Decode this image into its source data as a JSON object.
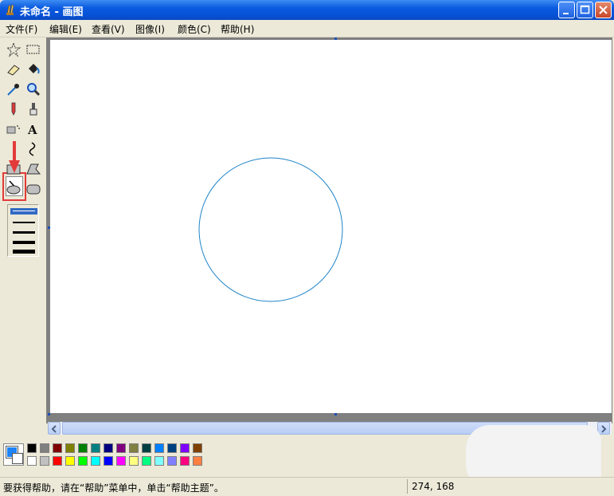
{
  "window": {
    "title": "未命名 - 画图",
    "controls": {
      "minimize": "minimize",
      "maximize": "maximize",
      "close": "close"
    }
  },
  "menu": {
    "items": [
      "文件(F)",
      "编辑(E)",
      "查看(V)",
      "图像(I)",
      "颜色(C)",
      "帮助(H)"
    ]
  },
  "toolbox": {
    "tools": [
      "free-form-select",
      "select",
      "eraser",
      "fill-with-color",
      "pick-color",
      "magnifier",
      "pencil",
      "brush",
      "airbrush",
      "text",
      "line",
      "curve",
      "rectangle",
      "polygon",
      "ellipse",
      "rounded-rectangle"
    ],
    "selected_tool": "line",
    "text_tool_glyph": "A",
    "line_widths_selected_index": 0
  },
  "canvas": {
    "shape": "circle",
    "stroke_color": "#1e84c8",
    "background": "#ffffff"
  },
  "palette": {
    "foreground": "#1e84f7",
    "background": "#ffffff",
    "row1": [
      "#000000",
      "#808080",
      "#800000",
      "#808000",
      "#008000",
      "#008080",
      "#000080",
      "#800080",
      "#808040",
      "#004040",
      "#0080ff",
      "#004080",
      "#8000ff",
      "#804000"
    ],
    "row2": [
      "#ffffff",
      "#c0c0c0",
      "#ff0000",
      "#ffff00",
      "#00ff00",
      "#00ffff",
      "#0000ff",
      "#ff00ff",
      "#ffff80",
      "#00ff80",
      "#80ffff",
      "#8080ff",
      "#ff0080",
      "#ff8040"
    ]
  },
  "status": {
    "help_text": "要获得帮助，请在“帮助”菜单中，单击“帮助主题”。",
    "coords": "274, 168"
  }
}
